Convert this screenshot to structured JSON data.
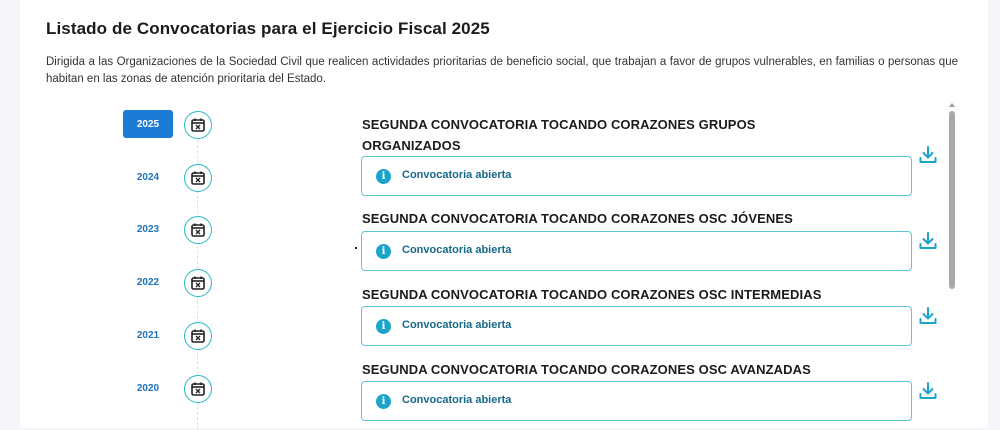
{
  "header": {
    "title": "Listado de Convocatorias para el Ejercicio Fiscal 2025",
    "intro": "Dirigida a las Organizaciones de la Sociedad Civil que realicen actividades prioritarias de beneficio social, que trabajan a favor de grupos vulnerables, en familias o personas que habitan en las zonas de atención prioritaria del Estado."
  },
  "timeline": {
    "years": [
      {
        "label": "2025",
        "active": true
      },
      {
        "label": "2024",
        "active": false
      },
      {
        "label": "2023",
        "active": false
      },
      {
        "label": "2022",
        "active": false
      },
      {
        "label": "2021",
        "active": false
      },
      {
        "label": "2020",
        "active": false
      }
    ],
    "icon": "calendar-x-icon"
  },
  "convocatorias": [
    {
      "title": "SEGUNDA CONVOCATORIA TOCANDO CORAZONES GRUPOS ORGANIZADOS",
      "status": "Convocatoria abierta"
    },
    {
      "title": "SEGUNDA CONVOCATORIA TOCANDO CORAZONES OSC JÓVENES",
      "status": "Convocatoria abierta"
    },
    {
      "title": "SEGUNDA CONVOCATORIA TOCANDO CORAZONES OSC INTERMEDIAS",
      "status": "Convocatoria abierta"
    },
    {
      "title": "SEGUNDA CONVOCATORIA TOCANDO CORAZONES OSC AVANZADAS",
      "status": "Convocatoria abierta"
    }
  ],
  "icons": {
    "status": "info-icon",
    "download": "download-icon"
  },
  "colors": {
    "accent": "#1a7cd4",
    "teal": "#2bb7cc",
    "status_text": "#16698a"
  }
}
